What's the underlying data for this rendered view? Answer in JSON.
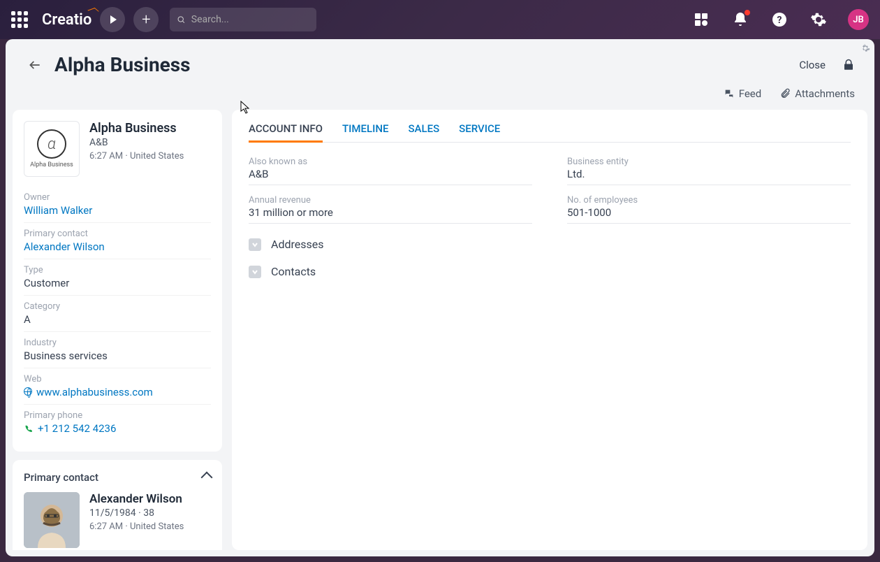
{
  "topbar": {
    "logo": "Creatio",
    "search_placeholder": "Search...",
    "avatar_initials": "JB"
  },
  "header": {
    "title": "Alpha Business",
    "close": "Close",
    "feed": "Feed",
    "attachments": "Attachments"
  },
  "company": {
    "name": "Alpha Business",
    "short": "A&B",
    "time": "6:27 AM",
    "country": "United States",
    "logo_text": "Alpha Business",
    "logo_symbol": "α"
  },
  "sidebarFields": {
    "owner_label": "Owner",
    "owner": "William Walker",
    "primary_contact_label": "Primary contact",
    "primary_contact": "Alexander Wilson",
    "type_label": "Type",
    "type": "Customer",
    "category_label": "Category",
    "category": "A",
    "industry_label": "Industry",
    "industry": "Business services",
    "web_label": "Web",
    "web": "www.alphabusiness.com",
    "phone_label": "Primary phone",
    "phone": "+1 212 542 4236"
  },
  "primaryContactSection": {
    "title": "Primary contact",
    "name": "Alexander Wilson",
    "dob": "11/5/1984",
    "age": "38",
    "time": "6:27 AM",
    "country": "United States"
  },
  "tabs": {
    "account_info": "ACCOUNT INFO",
    "timeline": "TIMELINE",
    "sales": "SALES",
    "service": "SERVICE"
  },
  "accountInfo": {
    "aka_label": "Also known as",
    "aka": "A&B",
    "entity_label": "Business entity",
    "entity": "Ltd.",
    "revenue_label": "Annual revenue",
    "revenue": "31 million or more",
    "employees_label": "No. of employees",
    "employees": "501-1000",
    "addresses": "Addresses",
    "contacts": "Contacts"
  }
}
